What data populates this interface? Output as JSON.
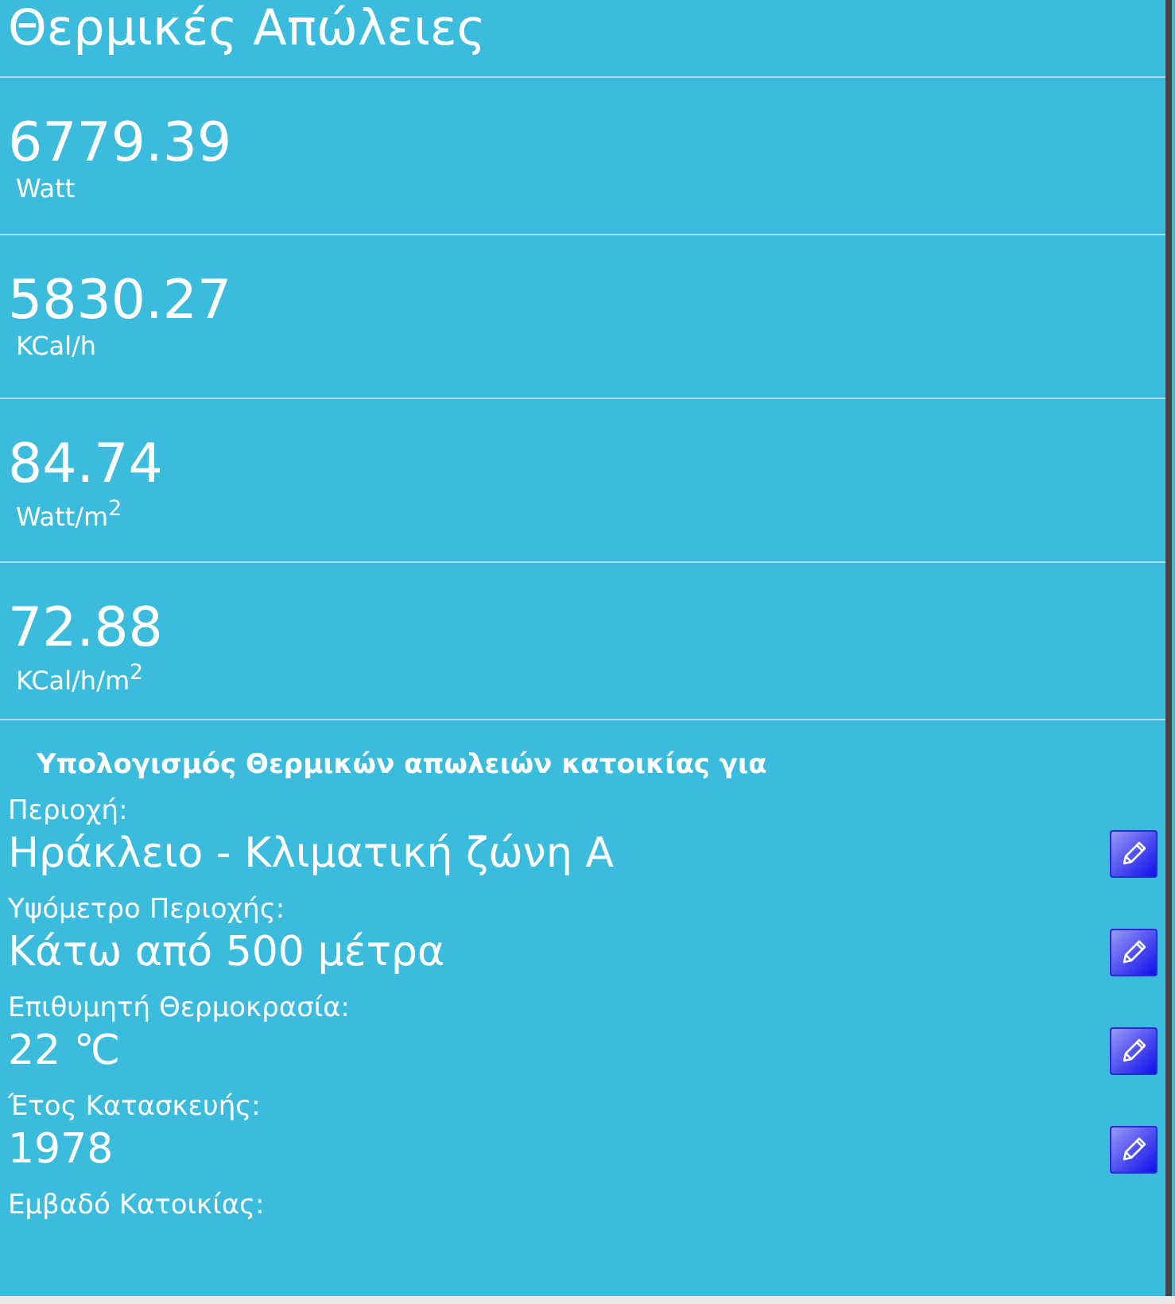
{
  "title": "Θερμικές Απώλειες",
  "results": [
    {
      "value": "6779.39",
      "unit": "Watt"
    },
    {
      "value": "5830.27",
      "unit": "KCal/h"
    },
    {
      "value": "84.74",
      "unit": "Watt/m$^{2}$"
    },
    {
      "value": "72.88",
      "unit": "KCal/h/m$^{2}$"
    }
  ],
  "section_heading": "Υπολογισμός Θερμικών απωλειών κατοικίας για",
  "fields": [
    {
      "label": "Περιοχή:",
      "value": "Ηράκλειο - Κλιματική ζώνη Α"
    },
    {
      "label": "Υψόμετρο Περιοχής:",
      "value": "Κάτω από 500 μέτρα"
    },
    {
      "label": "Επιθυμητή Θερμοκρασία:",
      "value": "22 ℃"
    },
    {
      "label": "Έτος Κατασκευής:",
      "value": "1978"
    },
    {
      "label": "Εμβαδό Κατοικίας:"
    }
  ]
}
